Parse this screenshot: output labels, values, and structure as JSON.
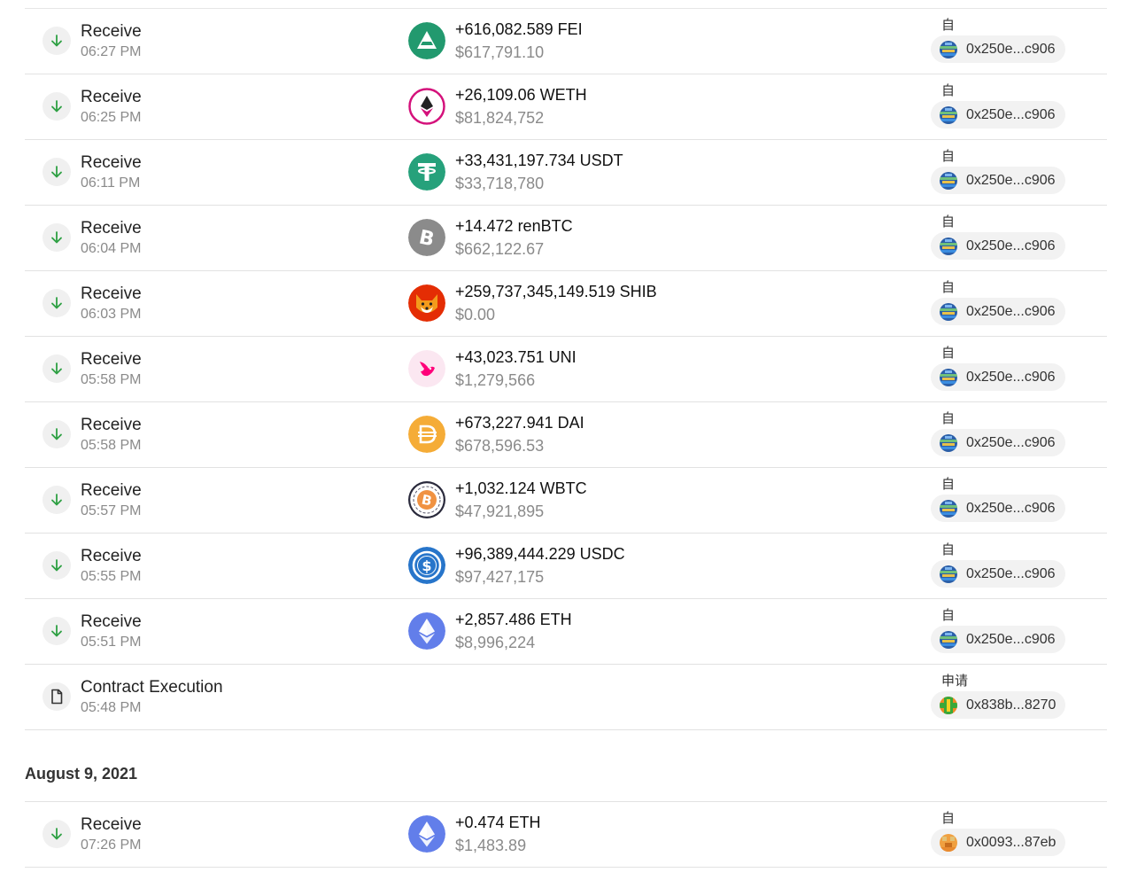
{
  "colors": {
    "receive_arrow": "#2ea043",
    "muted_text": "#8a8a8a",
    "divider": "#e2e2e2",
    "pill_bg": "#f2f2f2"
  },
  "groups": [
    {
      "date": "",
      "rows": [
        {
          "type": "Receive",
          "time": "06:27 PM",
          "icon": "arrow-down-icon",
          "token": "fei",
          "amount": "+616,082.589 FEI",
          "fiat": "$617,791.10",
          "direction": "自",
          "address": "0x250e...c906",
          "avatar": "blue"
        },
        {
          "type": "Receive",
          "time": "06:25 PM",
          "icon": "arrow-down-icon",
          "token": "weth",
          "amount": "+26,109.06 WETH",
          "fiat": "$81,824,752",
          "direction": "自",
          "address": "0x250e...c906",
          "avatar": "blue"
        },
        {
          "type": "Receive",
          "time": "06:11 PM",
          "icon": "arrow-down-icon",
          "token": "usdt",
          "amount": "+33,431,197.734 USDT",
          "fiat": "$33,718,780",
          "direction": "自",
          "address": "0x250e...c906",
          "avatar": "blue"
        },
        {
          "type": "Receive",
          "time": "06:04 PM",
          "icon": "arrow-down-icon",
          "token": "renbtc",
          "amount": "+14.472 renBTC",
          "fiat": "$662,122.67",
          "direction": "自",
          "address": "0x250e...c906",
          "avatar": "blue"
        },
        {
          "type": "Receive",
          "time": "06:03 PM",
          "icon": "arrow-down-icon",
          "token": "shib",
          "amount": "+259,737,345,149.519 SHIB",
          "fiat": "$0.00",
          "direction": "自",
          "address": "0x250e...c906",
          "avatar": "blue"
        },
        {
          "type": "Receive",
          "time": "05:58 PM",
          "icon": "arrow-down-icon",
          "token": "uni",
          "amount": "+43,023.751 UNI",
          "fiat": "$1,279,566",
          "direction": "自",
          "address": "0x250e...c906",
          "avatar": "blue"
        },
        {
          "type": "Receive",
          "time": "05:58 PM",
          "icon": "arrow-down-icon",
          "token": "dai",
          "amount": "+673,227.941 DAI",
          "fiat": "$678,596.53",
          "direction": "自",
          "address": "0x250e...c906",
          "avatar": "blue"
        },
        {
          "type": "Receive",
          "time": "05:57 PM",
          "icon": "arrow-down-icon",
          "token": "wbtc",
          "amount": "+1,032.124 WBTC",
          "fiat": "$47,921,895",
          "direction": "自",
          "address": "0x250e...c906",
          "avatar": "blue"
        },
        {
          "type": "Receive",
          "time": "05:55 PM",
          "icon": "arrow-down-icon",
          "token": "usdc",
          "amount": "+96,389,444.229 USDC",
          "fiat": "$97,427,175",
          "direction": "自",
          "address": "0x250e...c906",
          "avatar": "blue"
        },
        {
          "type": "Receive",
          "time": "05:51 PM",
          "icon": "arrow-down-icon",
          "token": "eth",
          "amount": "+2,857.486 ETH",
          "fiat": "$8,996,224",
          "direction": "自",
          "address": "0x250e...c906",
          "avatar": "blue"
        },
        {
          "type": "Contract Execution",
          "time": "05:48 PM",
          "icon": "document-icon",
          "token": "",
          "amount": "",
          "fiat": "",
          "direction": "申请",
          "address": "0x838b...8270",
          "avatar": "green"
        }
      ]
    },
    {
      "date": "August 9, 2021",
      "rows": [
        {
          "type": "Receive",
          "time": "07:26 PM",
          "icon": "arrow-down-icon",
          "token": "eth",
          "amount": "+0.474 ETH",
          "fiat": "$1,483.89",
          "direction": "自",
          "address": "0x0093...87eb",
          "avatar": "orange"
        }
      ]
    }
  ]
}
